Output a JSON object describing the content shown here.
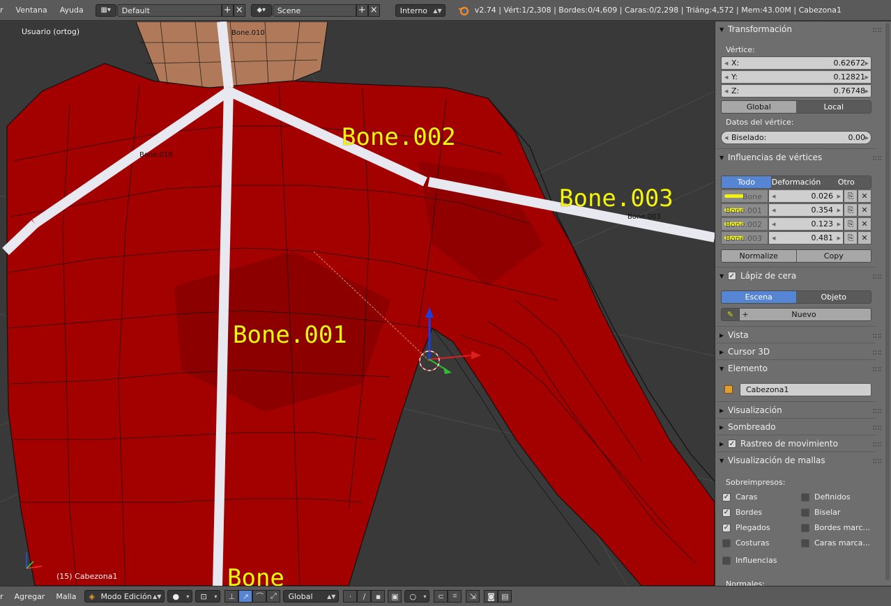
{
  "topbar": {
    "menu": [
      "r",
      "Ventana",
      "Ayuda"
    ],
    "layout_name": "Default",
    "scene_name": "Scene",
    "render_engine": "Interno",
    "stats": "v2.74 | Vért:1/2,308 | Bordes:0/4,609 | Caras:0/2,298 | Triáng:4,572 | Mem:43.00M | Cabezona1"
  },
  "viewport": {
    "view_name": "Usuario (ortog)",
    "object_info": "(15) Cabezona1",
    "bone_labels_large": [
      "Bone.002",
      "Bone.003",
      "Bone.001",
      "Bone"
    ],
    "bone_labels_small": [
      "Bone.010",
      "Bone.018",
      "Bone.003"
    ]
  },
  "properties": {
    "transform": {
      "title": "Transformación",
      "vertex_label": "Vértice:",
      "x_label": "X:",
      "x": "0.62672",
      "y_label": "Y:",
      "y": "0.12821",
      "z_label": "Z:",
      "z": "0.76748",
      "global": "Global",
      "local": "Local",
      "vertex_data": "Datos del vértice:",
      "bevel_label": "Biselado:",
      "bevel": "0.00"
    },
    "influences": {
      "title": "Influencias de vértices",
      "tabs": [
        "Todo",
        "Deformación",
        "Otro"
      ],
      "rows": [
        {
          "name": "Bone",
          "value": "0.026"
        },
        {
          "name": "Bone.001",
          "value": "0.354"
        },
        {
          "name": "Bone.002",
          "value": "0.123"
        },
        {
          "name": "Bone.003",
          "value": "0.481"
        }
      ],
      "normalize": "Normalize",
      "copy": "Copy"
    },
    "grease_pencil": {
      "title": "Lápiz de cera",
      "scene": "Escena",
      "object": "Objeto",
      "new": "Nuevo"
    },
    "collapsed": {
      "view": "Vista",
      "cursor": "Cursor 3D"
    },
    "item": {
      "title": "Elemento",
      "name": "Cabezona1"
    },
    "collapsed2": {
      "display": "Visualización",
      "shading": "Sombreado",
      "motion_tracking": "Rastreo de movimiento"
    },
    "mesh_display": {
      "title": "Visualización de mallas",
      "overlays": "Sobreimpresos:",
      "faces": "Caras",
      "edges": "Bordes",
      "creases": "Plegados",
      "seams": "Costuras",
      "weights": "Influencias",
      "sharp": "Definidos",
      "bevel": "Biselar",
      "marked_edges": "Bordes marc...",
      "marked_faces": "Caras marca...",
      "normals": "Normales:"
    }
  },
  "bottombar": {
    "menu": [
      "r",
      "Agregar",
      "Malla"
    ],
    "mode": "Modo Edición",
    "orientation": "Global"
  }
}
